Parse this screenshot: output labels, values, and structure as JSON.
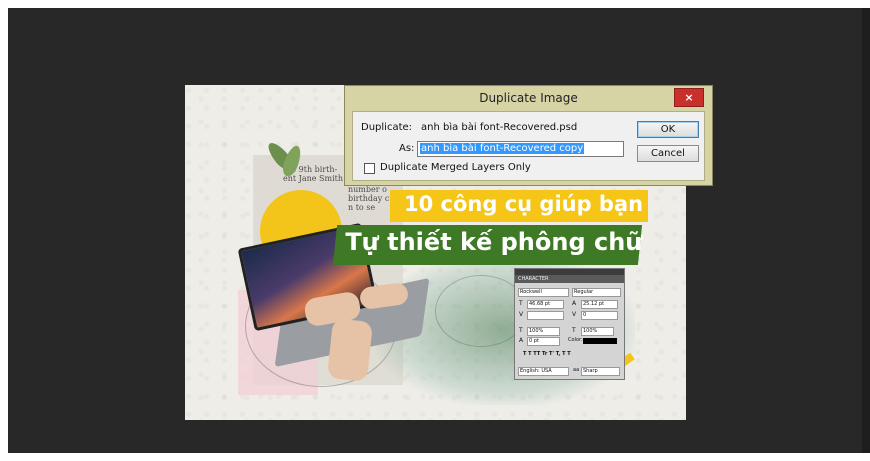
{
  "dialog": {
    "title": "Duplicate Image",
    "close_glyph": "×",
    "duplicate_label": "Duplicate:",
    "duplicate_filename": "anh bìa bài font-Recovered.psd",
    "as_label": "As:",
    "as_value": "anh bìa bài font-Recovered copy",
    "checkbox_label": "Duplicate Merged Layers Only",
    "checkbox_checked": false,
    "ok_label": "OK",
    "cancel_label": "Cancel"
  },
  "artwork": {
    "headline_1": "10 công cụ giúp bạn",
    "headline_2": "Tự thiết kế phông chữ",
    "news_line_1": "the 9th birth-",
    "news_line_2": "ent Jane Smith",
    "news_line_3": "number o",
    "news_line_4": "birthday c",
    "news_line_5": "n to se"
  },
  "character_panel": {
    "tab": "CHARACTER",
    "font_family": "Rockwell",
    "font_style": "Regular",
    "size": "46.68 pt",
    "leading": "25.12 pt",
    "tracking": "0",
    "vertical_scale": "100%",
    "horizontal_scale": "100%",
    "baseline": "0 pt",
    "color_label": "Color:",
    "language": "English: USA",
    "aa_label": "aa",
    "antialias": "Sharp",
    "style_buttons": "T  T  TT  Tr  T'  T,  T  T"
  },
  "colors": {
    "workspace": "#282828",
    "dialog_frame": "#d6d3a4",
    "close_button": "#c9302c",
    "selection": "#3399ff",
    "banner_yellow": "#f5c518",
    "banner_green": "#3e7a25"
  }
}
